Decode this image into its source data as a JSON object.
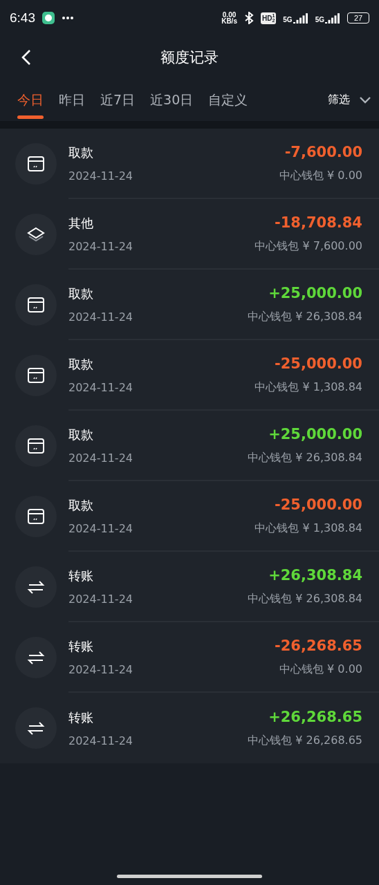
{
  "status_bar": {
    "time": "6:43",
    "net_speed": "0.00",
    "net_unit": "KB/s",
    "hd": "HD",
    "hd_sub": "1",
    "hd_sub2": "2",
    "signal_1": "5G",
    "signal_2": "5G",
    "battery": "27"
  },
  "header": {
    "title": "额度记录"
  },
  "tabs": [
    {
      "label": "今日",
      "selected": true
    },
    {
      "label": "昨日",
      "selected": false
    },
    {
      "label": "近7日",
      "selected": false
    },
    {
      "label": "近30日",
      "selected": false
    },
    {
      "label": "自定义",
      "selected": false
    }
  ],
  "filter": {
    "label": "筛选"
  },
  "records": [
    {
      "kind": "withdraw",
      "title": "取款",
      "date": "2024-11-24",
      "amount": "-7,600.00",
      "color": "#f0602e",
      "balance": "中心钱包 ¥ 0.00"
    },
    {
      "kind": "other",
      "title": "其他",
      "date": "2024-11-24",
      "amount": "-18,708.84",
      "color": "#f0602e",
      "balance": "中心钱包 ¥ 7,600.00"
    },
    {
      "kind": "withdraw",
      "title": "取款",
      "date": "2024-11-24",
      "amount": "+25,000.00",
      "color": "#5fd83a",
      "balance": "中心钱包 ¥ 26,308.84"
    },
    {
      "kind": "withdraw",
      "title": "取款",
      "date": "2024-11-24",
      "amount": "-25,000.00",
      "color": "#f0602e",
      "balance": "中心钱包 ¥ 1,308.84"
    },
    {
      "kind": "withdraw",
      "title": "取款",
      "date": "2024-11-24",
      "amount": "+25,000.00",
      "color": "#5fd83a",
      "balance": "中心钱包 ¥ 26,308.84"
    },
    {
      "kind": "withdraw",
      "title": "取款",
      "date": "2024-11-24",
      "amount": "-25,000.00",
      "color": "#f0602e",
      "balance": "中心钱包 ¥ 1,308.84"
    },
    {
      "kind": "transfer",
      "title": "转账",
      "date": "2024-11-24",
      "amount": "+26,308.84",
      "color": "#5fd83a",
      "balance": "中心钱包 ¥ 26,308.84"
    },
    {
      "kind": "transfer",
      "title": "转账",
      "date": "2024-11-24",
      "amount": "-26,268.65",
      "color": "#f0602e",
      "balance": "中心钱包 ¥ 0.00"
    },
    {
      "kind": "transfer",
      "title": "转账",
      "date": "2024-11-24",
      "amount": "+26,268.65",
      "color": "#5fd83a",
      "balance": "中心钱包 ¥ 26,268.65"
    }
  ]
}
